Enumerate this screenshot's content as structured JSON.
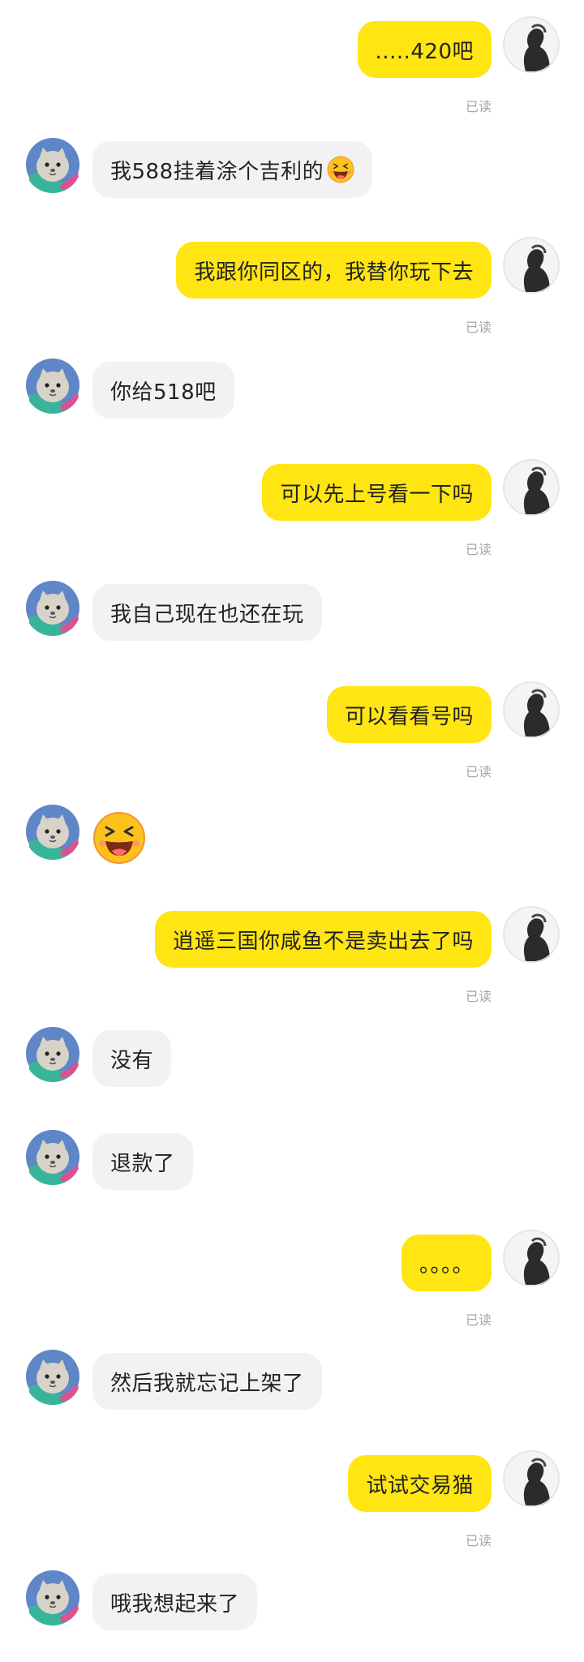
{
  "conversation": {
    "read_label": "已读",
    "messages": [
      {
        "from": "me",
        "text": ".....420吧",
        "read": true
      },
      {
        "from": "peer",
        "text": "我588挂着涂个吉利的",
        "emoji": "laughing-face-icon"
      },
      {
        "from": "me",
        "text": "我跟你同区的，我替你玩下去",
        "read": true
      },
      {
        "from": "peer",
        "text": "你给518吧"
      },
      {
        "from": "me",
        "text": "可以先上号看一下吗",
        "read": true
      },
      {
        "from": "peer",
        "text": "我自己现在也还在玩"
      },
      {
        "from": "me",
        "text": "可以看看号吗",
        "read": true
      },
      {
        "from": "peer",
        "text": "",
        "emoji": "laughing-face-icon"
      },
      {
        "from": "me",
        "text": "逍遥三国你咸鱼不是卖出去了吗",
        "read": true
      },
      {
        "from": "peer",
        "text": "没有"
      },
      {
        "from": "peer",
        "text": "退款了"
      },
      {
        "from": "me",
        "text": "。。。。",
        "read": true
      },
      {
        "from": "peer",
        "text": "然后我就忘记上架了"
      },
      {
        "from": "me",
        "text": "试试交易猫",
        "read": true
      },
      {
        "from": "peer",
        "text": "哦我想起来了"
      }
    ]
  },
  "colors": {
    "my_bubble": "#ffe512",
    "peer_bubble": "#f2f2f4",
    "read_text": "#a6a6a6"
  }
}
